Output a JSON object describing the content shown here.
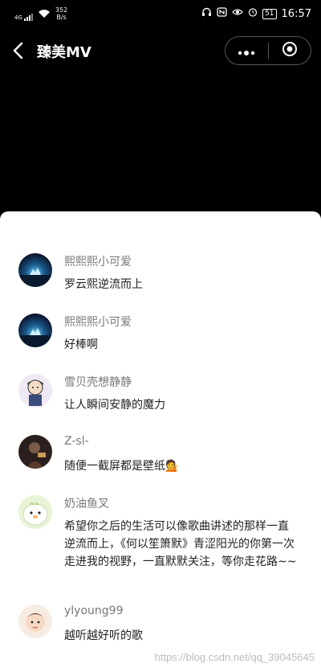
{
  "status_bar": {
    "signal": "4G",
    "net_speed_value": "352",
    "net_speed_unit": "B/s",
    "battery": "51",
    "time": "16:57"
  },
  "nav": {
    "title": "臻美MV"
  },
  "comments": [
    {
      "name": "熙熙熙小可爱",
      "text": "罗云熙逆流而上"
    },
    {
      "name": "熙熙熙小可爱",
      "text": "好棒啊"
    },
    {
      "name": "雪贝壳想静静",
      "text": "让人瞬间安静的魔力"
    },
    {
      "name": "Z-sl-",
      "text": "随便一截屏都是壁纸💁"
    },
    {
      "name": "奶油鱼叉",
      "text": "希望你之后的生活可以像歌曲讲述的那样一直逆流而上，《何以笙箫默》青涩阳光的你第一次走进我的视野，一直默默关注，等你走花路~~"
    },
    {
      "name": "ylyoung99",
      "text": "越听越好听的歌"
    }
  ],
  "watermark": "https://blog.csdn.net/qq_39045645"
}
